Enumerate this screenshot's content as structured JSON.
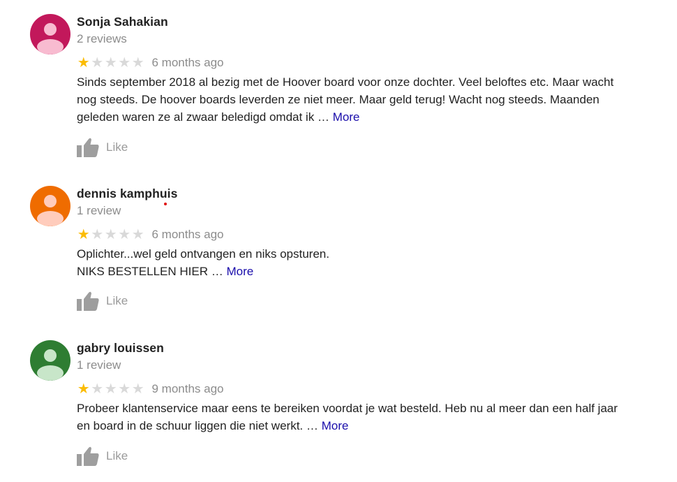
{
  "reviews": [
    {
      "name": "Sonja Sahakian",
      "count": "2 reviews",
      "rating": 1,
      "max_rating": 5,
      "time": "6 months ago",
      "text_lines": [
        "Sinds september 2018 al bezig met de Hoover board voor onze dochter. Veel beloftes etc. Maar wacht",
        "nog steeds. De hoover boards leverden ze niet meer. Maar geld terug! Wacht nog steeds. Maanden",
        "geleden waren ze al zwaar beledigd omdat ik … "
      ],
      "more_label": "More",
      "like_label": "Like",
      "avatar_bg": "#c2185b",
      "avatar_fg": "#f8bbd0"
    },
    {
      "name": "dennis kamphuis",
      "count": "1 review",
      "rating": 1,
      "max_rating": 5,
      "time": "6 months ago",
      "text_lines": [
        "Oplichter...wel geld ontvangen en niks opsturen.",
        "NIKS BESTELLEN HIER … "
      ],
      "more_label": "More",
      "like_label": "Like",
      "avatar_bg": "#ef6c00",
      "avatar_fg": "#ffccbc"
    },
    {
      "name": "gabry louissen",
      "count": "1 review",
      "rating": 1,
      "max_rating": 5,
      "time": "9 months ago",
      "text_lines": [
        "Probeer klantenservice maar eens te bereiken voordat je wat besteld. Heb nu al meer dan een half jaar",
        "en board in de schuur liggen die niet werkt. … "
      ],
      "more_label": "More",
      "like_label": "Like",
      "avatar_bg": "#2e7d32",
      "avatar_fg": "#c8e6c9"
    }
  ],
  "colors": {
    "star_filled": "#fbbc04",
    "star_empty": "#d9d9d9",
    "more_link": "#1a0dab",
    "secondary_text": "#8c8c8c",
    "like_icon": "#9e9e9e"
  },
  "icons": {
    "star": "star-icon",
    "like": "thumbs-up-icon",
    "avatar": "person-icon"
  }
}
